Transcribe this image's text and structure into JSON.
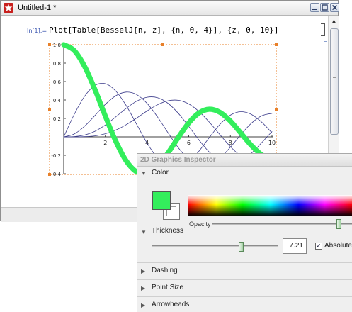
{
  "window": {
    "title": "Untitled-1 *"
  },
  "cell": {
    "in_label": "In[1]:=",
    "input": "Plot[Table[BesselJ[n, z], {n, 0, 4}], {z, 0, 10}]"
  },
  "chart_data": {
    "type": "line",
    "x_range": [
      0,
      10
    ],
    "y_range": [
      -0.4,
      1.0
    ],
    "x_ticks": [
      "2",
      "4",
      "6",
      "8",
      "10"
    ],
    "y_ticks": [
      "1.0",
      "0.8",
      "0.6",
      "0.4",
      "0.2",
      "-0.2",
      "-0.4"
    ],
    "series": [
      {
        "color": "#33ee5c",
        "thickness": 7.21,
        "x": [
          0,
          0.5,
          1,
          1.5,
          2,
          2.5,
          3,
          3.5,
          4,
          4.5,
          5,
          5.5,
          6,
          6.5,
          7,
          7.5,
          8,
          8.5,
          9,
          9.5,
          10
        ],
        "y": [
          1,
          0.938,
          0.765,
          0.512,
          0.224,
          -0.048,
          -0.26,
          -0.38,
          -0.397,
          -0.321,
          -0.178,
          -0.007,
          0.151,
          0.26,
          0.3,
          0.266,
          0.172,
          0.042,
          -0.09,
          -0.194,
          -0.246
        ]
      },
      {
        "color": "#3a3a8a",
        "x": [
          0,
          0.5,
          1,
          1.5,
          2,
          2.5,
          3,
          3.5,
          4,
          4.5,
          5,
          5.5,
          6,
          6.5,
          7,
          7.5,
          8,
          8.5,
          9,
          9.5,
          10
        ],
        "y": [
          0,
          0.242,
          0.44,
          0.558,
          0.577,
          0.497,
          0.339,
          0.137,
          -0.066,
          -0.231,
          -0.328,
          -0.341,
          -0.277,
          -0.154,
          -0.005,
          0.135,
          0.235,
          0.273,
          0.245,
          0.161,
          0.043
        ]
      },
      {
        "color": "#3a3a8a",
        "x": [
          0,
          0.5,
          1,
          1.5,
          2,
          2.5,
          3,
          3.5,
          4,
          4.5,
          5,
          5.5,
          6,
          6.5,
          7,
          7.5,
          8,
          8.5,
          9,
          9.5,
          10
        ],
        "y": [
          0,
          0.031,
          0.115,
          0.232,
          0.353,
          0.446,
          0.486,
          0.459,
          0.364,
          0.218,
          0.047,
          -0.117,
          -0.243,
          -0.307,
          -0.301,
          -0.23,
          -0.113,
          0.022,
          0.145,
          0.228,
          0.255
        ]
      },
      {
        "color": "#3a3a8a",
        "x": [
          0,
          0.5,
          1,
          1.5,
          2,
          2.5,
          3,
          3.5,
          4,
          4.5,
          5,
          5.5,
          6,
          6.5,
          7,
          7.5,
          8,
          8.5,
          9,
          9.5,
          10
        ],
        "y": [
          0,
          0.003,
          0.02,
          0.061,
          0.129,
          0.217,
          0.309,
          0.387,
          0.43,
          0.425,
          0.365,
          0.256,
          0.115,
          -0.035,
          -0.168,
          -0.258,
          -0.291,
          -0.262,
          -0.181,
          -0.065,
          0.058
        ]
      },
      {
        "color": "#3a3a8a",
        "x": [
          0,
          0.5,
          1,
          1.5,
          2,
          2.5,
          3,
          3.5,
          4,
          4.5,
          5,
          5.5,
          6,
          6.5,
          7,
          7.5,
          8,
          8.5,
          9,
          9.5,
          10
        ],
        "y": [
          0,
          0,
          0.002,
          0.011,
          0.034,
          0.074,
          0.132,
          0.204,
          0.281,
          0.348,
          0.391,
          0.397,
          0.358,
          0.274,
          0.158,
          0.024,
          -0.105,
          -0.207,
          -0.265,
          -0.269,
          -0.22
        ]
      }
    ]
  },
  "inspector": {
    "title": "2D Graphics Inspector",
    "color": {
      "label": "Color",
      "expanded": true,
      "selected": "#33ee5c",
      "opacity_label": "Opacity",
      "opacity": 1.0
    },
    "thickness": {
      "label": "Thickness",
      "expanded": true,
      "value": "7.21",
      "slider_fraction": 0.7,
      "absolute_label": "Absolute",
      "absolute_checked": true
    },
    "sections": [
      {
        "label": "Dashing"
      },
      {
        "label": "Point Size"
      },
      {
        "label": "Arrowheads"
      }
    ],
    "arrows": {
      "expanded": "▼",
      "collapsed": "▶"
    }
  }
}
